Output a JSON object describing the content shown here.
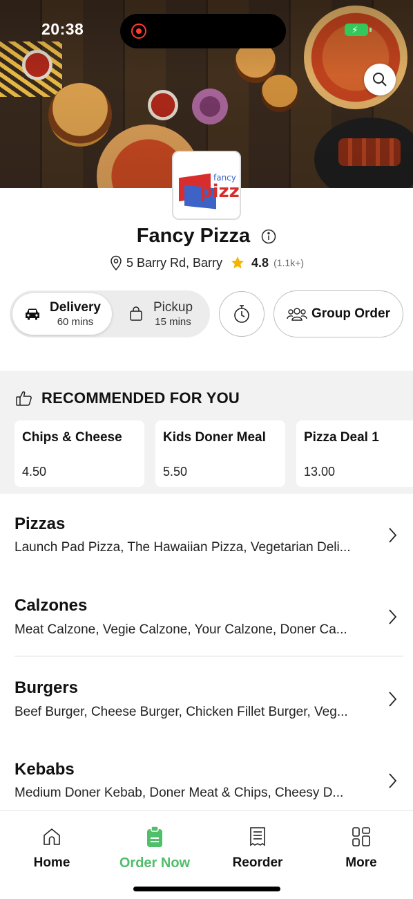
{
  "status_bar": {
    "time": "20:38"
  },
  "store": {
    "name": "Fancy Pizza",
    "address": "5 Barry Rd, Barry",
    "rating": "4.8",
    "rating_count": "(1.1k+)",
    "logo_text": {
      "fancy": "fancy",
      "pizza": "pizza"
    }
  },
  "order_modes": {
    "delivery": {
      "label": "Delivery",
      "time": "60 mins",
      "selected": true
    },
    "pickup": {
      "label": "Pickup",
      "time": "15 mins",
      "selected": false
    }
  },
  "group_order_label": "Group Order",
  "recommended": {
    "title": "RECOMMENDED FOR YOU",
    "items": [
      {
        "name": "Chips & Cheese",
        "price": "4.50"
      },
      {
        "name": "Kids Doner Meal",
        "price": "5.50"
      },
      {
        "name": "Pizza Deal 1",
        "price": "13.00"
      }
    ]
  },
  "categories": [
    {
      "name": "Pizzas",
      "items": "Launch Pad Pizza, The Hawaiian Pizza, Vegetarian Deli..."
    },
    {
      "name": "Calzones",
      "items": "Meat Calzone, Vegie Calzone, Your Calzone, Doner Ca..."
    },
    {
      "name": "Burgers",
      "items": "Beef Burger, Cheese Burger, Chicken Fillet Burger, Veg..."
    },
    {
      "name": "Kebabs",
      "items": "Medium Doner Kebab, Doner Meat & Chips, Cheesy D..."
    }
  ],
  "bottom_nav": [
    {
      "label": "Home",
      "icon": "home-icon",
      "active": false
    },
    {
      "label": "Order Now",
      "icon": "order-now-icon",
      "active": true
    },
    {
      "label": "Reorder",
      "icon": "receipt-icon",
      "active": false
    },
    {
      "label": "More",
      "icon": "grid-icon",
      "active": false
    }
  ],
  "colors": {
    "accent": "#4fbf6a",
    "star": "#f5b400",
    "battery": "#34c759",
    "record": "#ff3b30"
  }
}
